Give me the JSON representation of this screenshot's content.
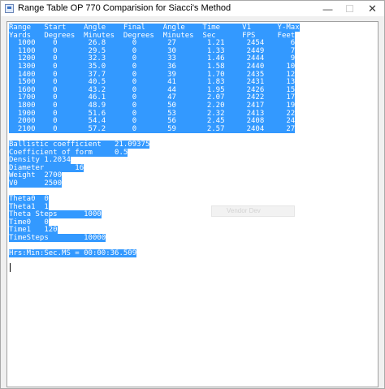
{
  "window": {
    "title": "Range Table OP 770 Comparision for Siacci's Method",
    "minimize_glyph": "—",
    "maximize_glyph": "☐",
    "close_glyph": "✕",
    "icon": "app-window-icon"
  },
  "output": {
    "lines": [
      "Range   Start    Angle    Final    Angle    Time     V1      Y-Max",
      "Yards   Degrees  Minutes  Degrees  Minutes  Sec      FPS     Feet",
      "  1000    0       26.8      0       27       1.21     2454      6",
      "  1100    0       29.5      0       30       1.33     2449      7",
      "  1200    0       32.3      0       33       1.46     2444      9",
      "  1300    0       35.0      0       36       1.58     2440     10",
      "  1400    0       37.7      0       39       1.70     2435     12",
      "  1500    0       40.5      0       41       1.83     2431     13",
      "  1600    0       43.2      0       44       1.95     2426     15",
      "  1700    0       46.1      0       47       2.07     2422     17",
      "  1800    0       48.9      0       50       2.20     2417     19",
      "  1900    0       51.6      0       53       2.32     2413     22",
      "  2000    0       54.4      0       56       2.45     2408     24",
      "  2100    0       57.2      0       59       2.57     2404     27",
      "",
      "Ballistic coefficient   21.09375",
      "Coefficient of form     0.5",
      "Density 1.2034",
      "Diameter       16",
      "Weight  2700",
      "V0      2500",
      "",
      "Theta0  0",
      "Theta1  1",
      "Theta Steps      1000",
      "Time0   0",
      "Time1   120",
      "TimeSteps        10000",
      "",
      "Hrs:Min:Sec.MS = 00:00:36.509",
      ""
    ],
    "ghost_tooltip": "Vendor Dev"
  }
}
